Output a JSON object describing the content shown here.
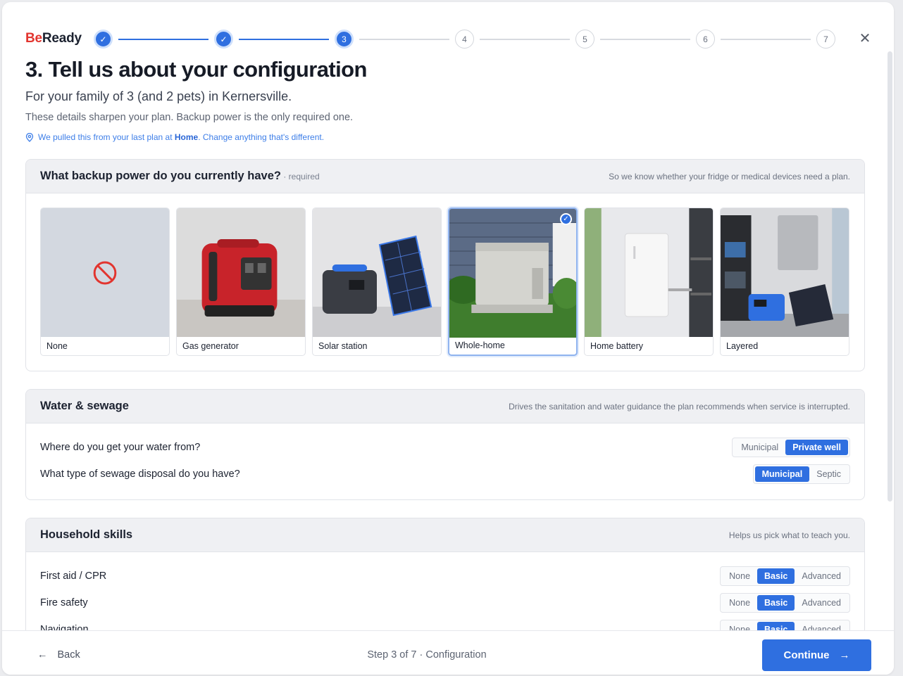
{
  "brand": {
    "be": "Be",
    "ready": "Ready"
  },
  "stepper": {
    "steps": [
      {
        "label": "✓",
        "state": "done"
      },
      {
        "label": "✓",
        "state": "done"
      },
      {
        "label": "3",
        "state": "current"
      },
      {
        "label": "4",
        "state": "todo"
      },
      {
        "label": "5",
        "state": "todo"
      },
      {
        "label": "6",
        "state": "todo"
      },
      {
        "label": "7",
        "state": "todo"
      }
    ],
    "close_icon": "close-icon"
  },
  "header": {
    "title": "3. Tell us about your configuration",
    "subtitle": "For your family of 3 (and 2 pets) in Kernersville.",
    "description": "These details sharpen your plan. Backup power is the only required one.",
    "note_prefix": "We pulled this from your last plan at ",
    "note_place": "Home",
    "note_suffix": ". Change anything that's different."
  },
  "backup_power": {
    "title": "What backup power do you currently have?",
    "required": " · required",
    "hint": "So we know whether your fridge or medical devices need a plan.",
    "options": [
      {
        "label": "None",
        "selected": false
      },
      {
        "label": "Gas generator",
        "selected": false
      },
      {
        "label": "Solar station",
        "selected": false
      },
      {
        "label": "Whole-home",
        "selected": true
      },
      {
        "label": "Home battery",
        "selected": false
      },
      {
        "label": "Layered",
        "selected": false
      }
    ]
  },
  "water": {
    "title": "Water & sewage",
    "hint": "Drives the sanitation and water guidance the plan recommends when service is interrupted.",
    "questions": [
      {
        "label": "Where do you get your water from?",
        "options": [
          "Municipal",
          "Private well"
        ],
        "selected": "Private well"
      },
      {
        "label": "What type of sewage disposal do you have?",
        "options": [
          "Municipal",
          "Septic"
        ],
        "selected": "Municipal"
      }
    ]
  },
  "skills": {
    "title": "Household skills",
    "hint": "Helps us pick what to teach you.",
    "questions": [
      {
        "label": "First aid / CPR",
        "options": [
          "None",
          "Basic",
          "Advanced"
        ],
        "selected": "Basic"
      },
      {
        "label": "Fire safety",
        "options": [
          "None",
          "Basic",
          "Advanced"
        ],
        "selected": "Basic"
      },
      {
        "label": "Navigation",
        "options": [
          "None",
          "Basic",
          "Advanced"
        ],
        "selected": "Basic"
      }
    ]
  },
  "footer": {
    "back_label": "Back",
    "step_info": "Step 3 of 7 · Configuration",
    "continue_label": "Continue"
  },
  "colors": {
    "accent": "#2f6fe0",
    "brand_red": "#e2352f"
  }
}
